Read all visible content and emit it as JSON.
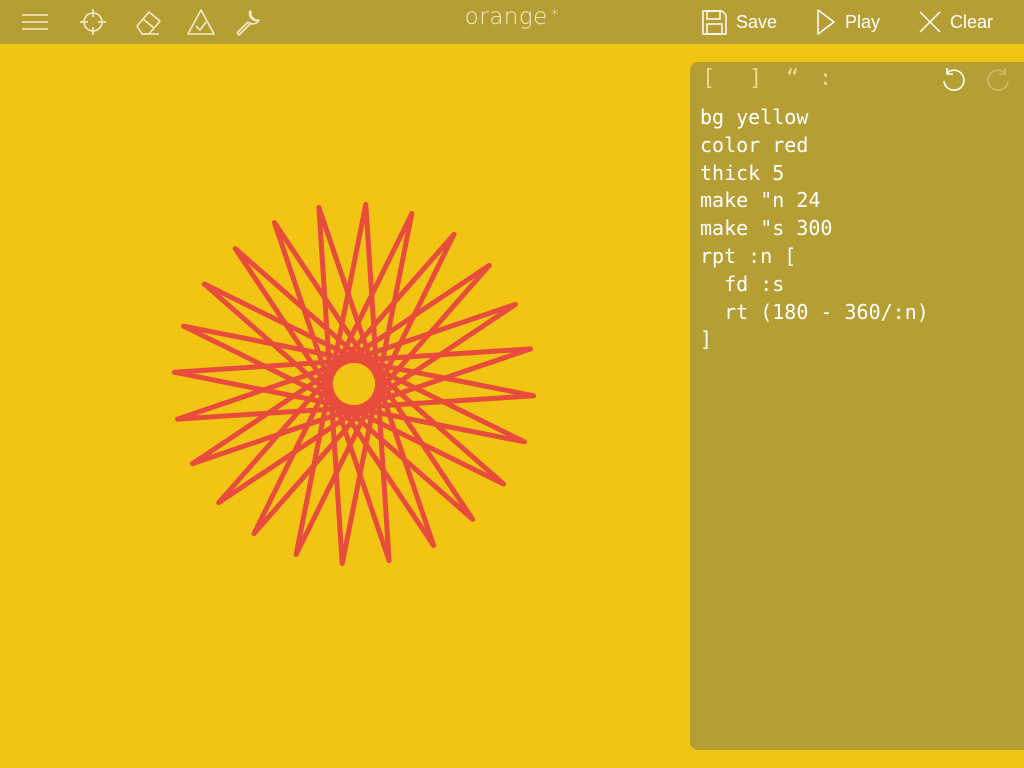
{
  "colors": {
    "background": "#F2C413",
    "toolbar": "#B59E34",
    "stroke": "#E84C3D",
    "icon": "#F4EBC8"
  },
  "toolbar": {
    "left_icons": [
      "menu-icon",
      "crosshair-icon",
      "eraser-icon",
      "triangle-check-icon",
      "wrench-icon"
    ],
    "title": "orange",
    "modified_marker": "*",
    "save_label": "Save",
    "play_label": "Play",
    "clear_label": "Clear"
  },
  "editor": {
    "insert_buttons": [
      "[",
      "]",
      "“",
      ":"
    ],
    "code_lines": [
      "bg yellow",
      "color red",
      "thick 5",
      "make \"n 24",
      "make \"s 300",
      "rpt :n [",
      "  fd :s",
      "  rt (180 - 360/:n)",
      "]"
    ]
  },
  "drawing": {
    "points": 24,
    "segment_length": 300,
    "turn_degrees": 165,
    "stroke_thickness": 5,
    "stroke_color": "#E84C3D"
  }
}
